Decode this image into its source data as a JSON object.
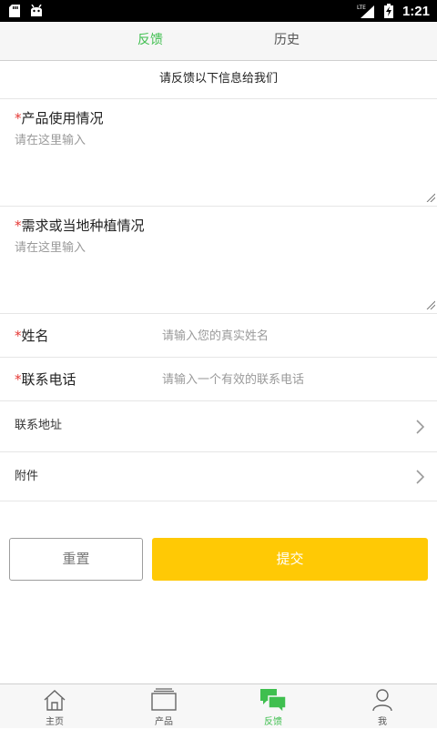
{
  "status_bar": {
    "network": "LTE",
    "time": "1:21"
  },
  "tabs": [
    {
      "label": "反馈",
      "active": true
    },
    {
      "label": "历史",
      "active": false
    }
  ],
  "intro_text": "请反馈以下信息给我们",
  "required_mark": "*",
  "form": {
    "usage": {
      "label": "产品使用情况",
      "placeholder": "请在这里输入"
    },
    "needs": {
      "label": "需求或当地种植情况",
      "placeholder": "请在这里输入"
    },
    "name": {
      "label": "姓名",
      "placeholder": "请输入您的真实姓名"
    },
    "phone": {
      "label": "联系电话",
      "placeholder": "请输入一个有效的联系电话"
    },
    "address": {
      "label": "联系地址"
    },
    "attachment": {
      "label": "附件"
    }
  },
  "buttons": {
    "reset": "重置",
    "submit": "提交"
  },
  "bottom_nav": [
    {
      "label": "主页",
      "icon": "home-icon",
      "active": false
    },
    {
      "label": "产品",
      "icon": "product-icon",
      "active": false
    },
    {
      "label": "反馈",
      "icon": "chat-bubbles-icon",
      "active": true
    },
    {
      "label": "我",
      "icon": "person-icon",
      "active": false
    }
  ],
  "colors": {
    "accent_green": "#3fbf4f",
    "submit_yellow": "#ffc905",
    "required_red": "#e53935"
  }
}
